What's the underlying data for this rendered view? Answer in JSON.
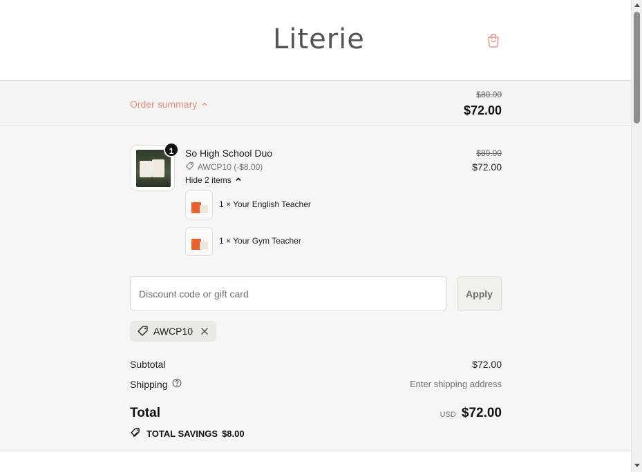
{
  "header": {
    "logo": "Literie",
    "cart_icon": "shopping-bag-icon",
    "accent_color": "#e48f86"
  },
  "summary_bar": {
    "toggle_label": "Order summary",
    "original_price": "$80.00",
    "price": "$72.00"
  },
  "product": {
    "quantity": "1",
    "name": "So High School Duo",
    "discount": "AWCP10 (-$8.00)",
    "hide_items_label": "Hide 2 items",
    "original_price": "$80.00",
    "price": "$72.00",
    "items": [
      {
        "label": "1 × Your English Teacher"
      },
      {
        "label": "1 × Your Gym Teacher"
      }
    ]
  },
  "discount_form": {
    "placeholder": "Discount code or gift card",
    "apply_label": "Apply",
    "applied_code": "AWCP10"
  },
  "totals": {
    "subtotal_label": "Subtotal",
    "subtotal_value": "$72.00",
    "shipping_label": "Shipping",
    "shipping_value": "Enter shipping address",
    "total_label": "Total",
    "currency": "USD",
    "total_value": "$72.00",
    "savings_label": "TOTAL SAVINGS",
    "savings_value": "$8.00"
  }
}
